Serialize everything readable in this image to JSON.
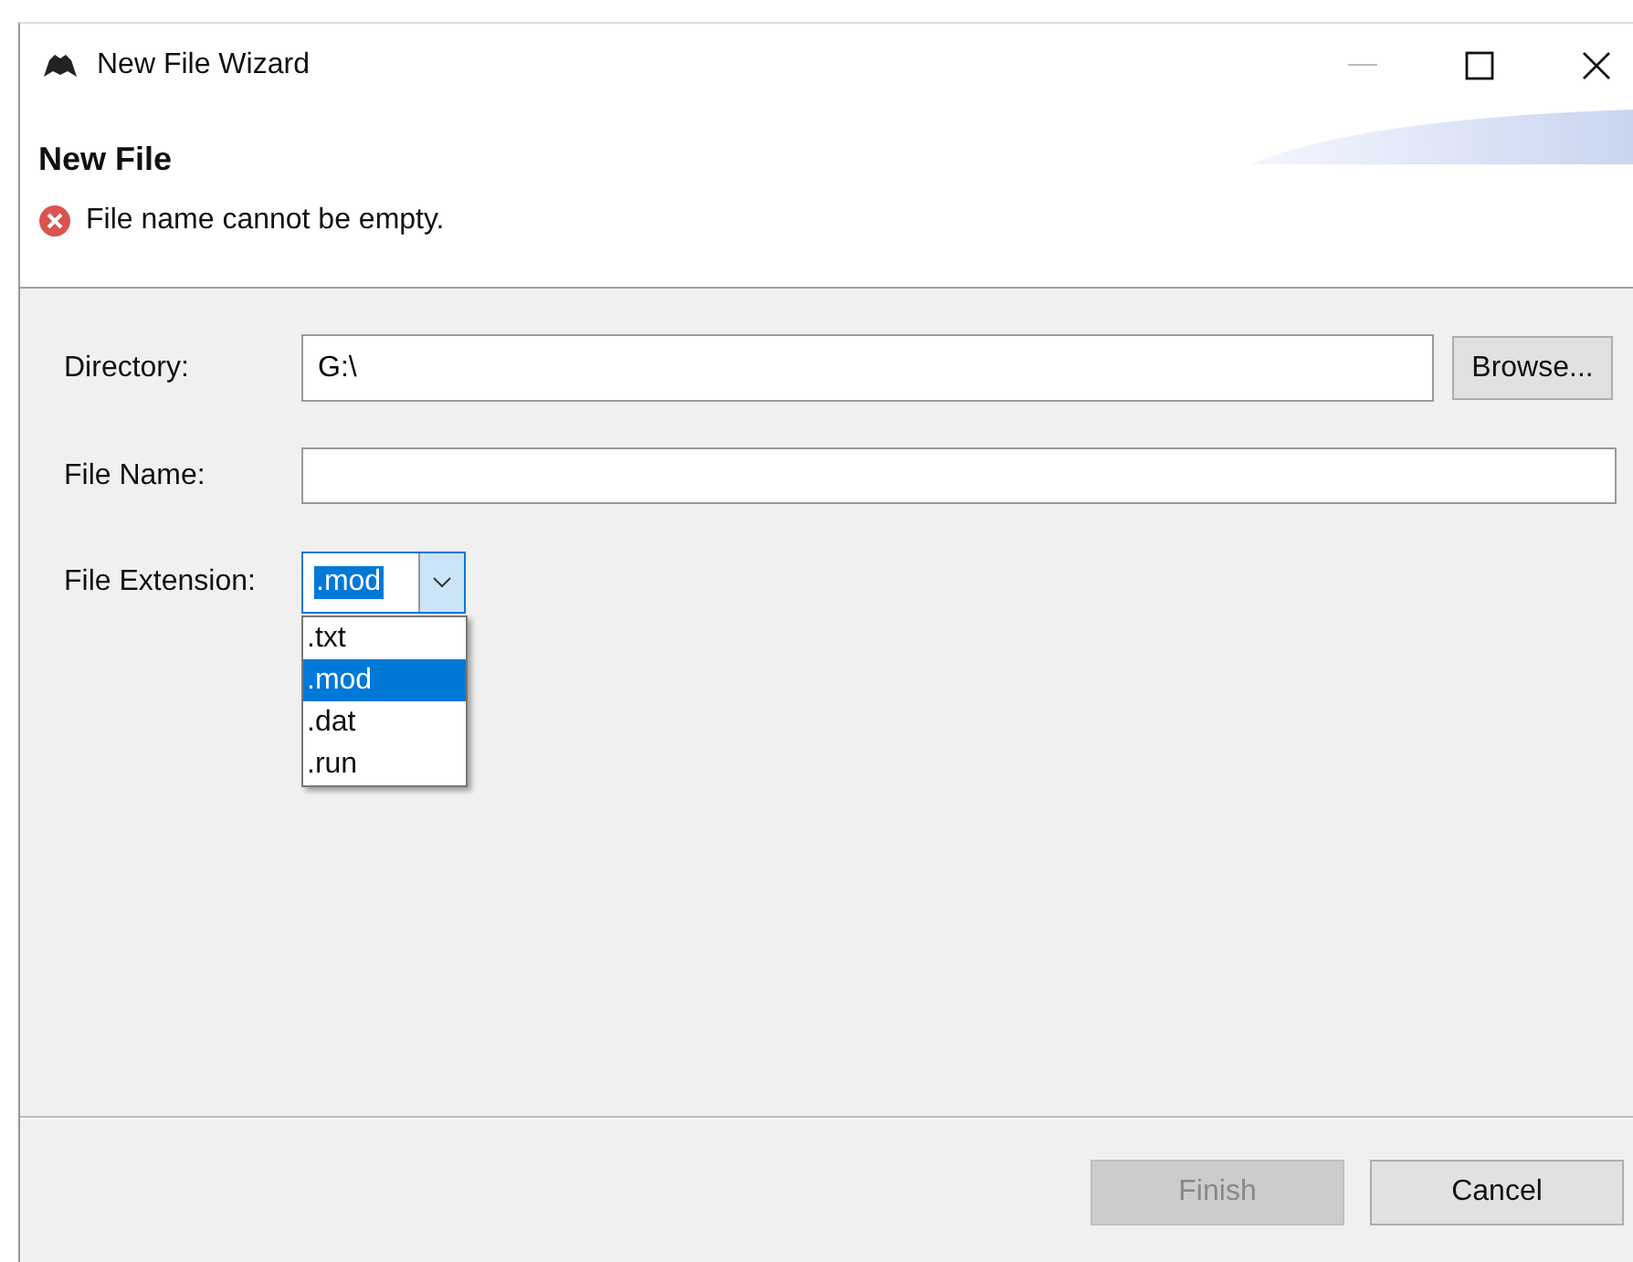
{
  "window": {
    "title": "New File Wizard"
  },
  "header": {
    "title": "New File",
    "message": {
      "kind": "error",
      "text": "File name cannot be empty."
    }
  },
  "form": {
    "directory": {
      "label": "Directory:",
      "value": "G:\\",
      "browse": "Browse..."
    },
    "file_name": {
      "label": "File Name:"
    },
    "extension": {
      "label": "File Extension:",
      "value": ".mod",
      "expanded": true,
      "options": [
        {
          "label": ".txt",
          "selected": false
        },
        {
          "label": ".mod",
          "selected": true
        },
        {
          "label": ".dat",
          "selected": false
        },
        {
          "label": ".run",
          "selected": false
        }
      ]
    }
  },
  "buttons": [
    {
      "label": "Finish",
      "disabled": true
    },
    {
      "label": "Cancel",
      "disabled": false
    }
  ]
}
